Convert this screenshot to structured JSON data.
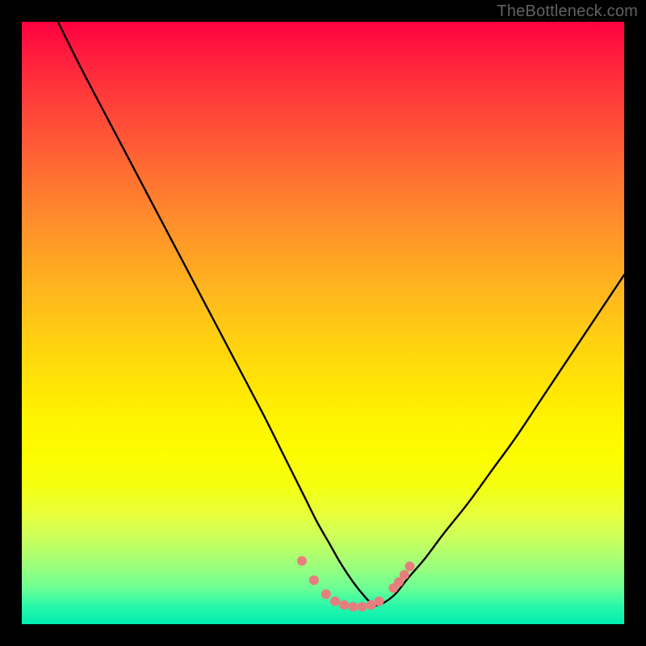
{
  "watermark": "TheBottleneck.com",
  "chart_data": {
    "type": "line",
    "title": "",
    "xlabel": "",
    "ylabel": "",
    "xlim": [
      0,
      100
    ],
    "ylim": [
      0,
      100
    ],
    "grid": false,
    "legend": false,
    "series": [
      {
        "name": "left-branch",
        "color": "#000000",
        "x": [
          6,
          10,
          15,
          20,
          25,
          30,
          35,
          40,
          43,
          45,
          47,
          49,
          51,
          53,
          55,
          57,
          58.5
        ],
        "y": [
          100,
          92,
          82.5,
          73,
          63.5,
          54,
          44.5,
          35,
          29,
          25,
          21,
          17,
          13.5,
          10,
          7,
          4.5,
          3
        ]
      },
      {
        "name": "right-branch",
        "color": "#000000",
        "x": [
          58.5,
          60,
          62,
          64,
          67,
          70,
          74,
          78,
          82,
          86,
          90,
          94,
          98,
          100
        ],
        "y": [
          3,
          3.5,
          5,
          7.5,
          11,
          15,
          20,
          25.5,
          31,
          37,
          43,
          49,
          55,
          58
        ]
      }
    ],
    "markers": {
      "name": "highlight-points",
      "color": "#e77e7e",
      "radius_px": 6,
      "points": [
        {
          "x": 46.5,
          "y": 10.5
        },
        {
          "x": 48.5,
          "y": 7.3
        },
        {
          "x": 50.5,
          "y": 5.0
        },
        {
          "x": 52.0,
          "y": 3.8
        },
        {
          "x": 53.5,
          "y": 3.2
        },
        {
          "x": 55.0,
          "y": 2.9
        },
        {
          "x": 56.5,
          "y": 2.9
        },
        {
          "x": 58.0,
          "y": 3.2
        },
        {
          "x": 59.3,
          "y": 3.8
        },
        {
          "x": 61.7,
          "y": 6.0
        },
        {
          "x": 62.6,
          "y": 7.0
        },
        {
          "x": 63.5,
          "y": 8.2
        },
        {
          "x": 64.4,
          "y": 9.6
        }
      ]
    },
    "background_gradient": {
      "orientation": "vertical",
      "stops": [
        {
          "pos": 0.0,
          "color": "#ff0040"
        },
        {
          "pos": 0.5,
          "color": "#ffd000"
        },
        {
          "pos": 0.78,
          "color": "#f6ff20"
        },
        {
          "pos": 1.0,
          "color": "#00eeb0"
        }
      ]
    }
  }
}
